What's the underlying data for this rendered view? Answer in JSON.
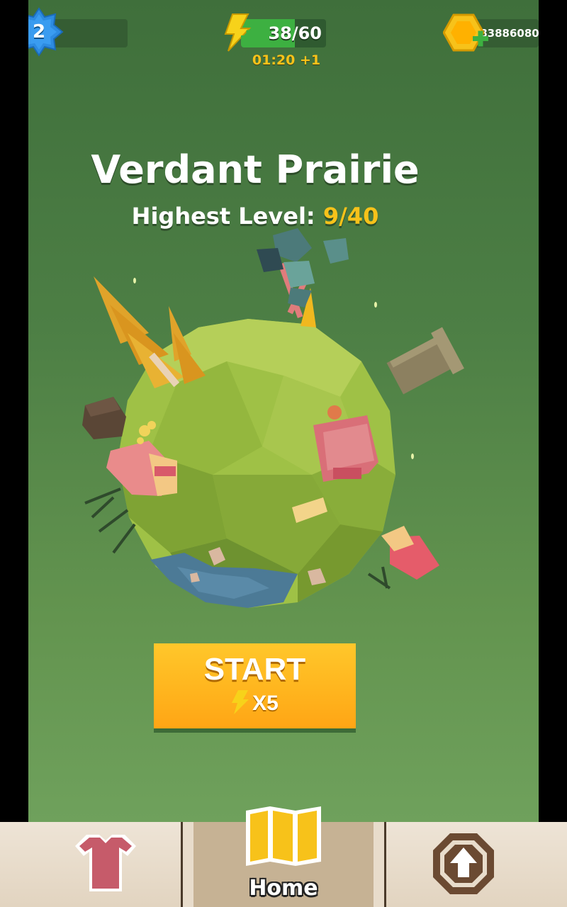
{
  "hud": {
    "level": "2",
    "energy": {
      "current": 38,
      "max": 60,
      "text": "38/60",
      "fill_fraction": 0.63
    },
    "timer": "01:20 +1",
    "coins": "83886080"
  },
  "world": {
    "title": "Verdant Prairie",
    "highest_label": "Highest Level:",
    "highest_value": "9/40"
  },
  "start_button": {
    "label": "START",
    "cost": "X5"
  },
  "nav": {
    "tabs": [
      {
        "name": "shop",
        "icon": "shirt-icon",
        "label": ""
      },
      {
        "name": "home",
        "icon": "map-icon",
        "label": "Home",
        "active": true
      },
      {
        "name": "upgrade",
        "icon": "upgrade-arrow-icon",
        "label": ""
      }
    ]
  },
  "colors": {
    "bg_top": "#3f6f3b",
    "bg_bottom": "#6fa15c",
    "accent_yellow": "#f7c21a",
    "start_orange": "#ffb51e",
    "level_blue": "#2d8be0",
    "nav_bg": "#e8dccb"
  }
}
